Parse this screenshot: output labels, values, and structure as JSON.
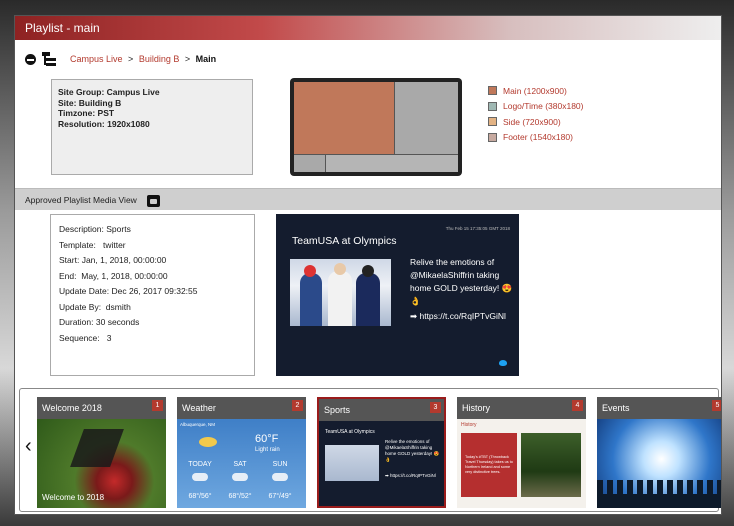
{
  "window": {
    "title": "Playlist - main"
  },
  "breadcrumb": {
    "items": [
      "Campus Live",
      "Building B"
    ],
    "current": "Main",
    "separator": ">"
  },
  "site_info": {
    "site_group_label": "Site Group:",
    "site_group": "Campus Live",
    "site_label": "Site:",
    "site": "Building B",
    "timezone_label": "Timzone:",
    "timezone": "PST",
    "resolution_label": "Resolution:",
    "resolution": "1920x1080"
  },
  "layout_legend": [
    {
      "label": "Main (1200x900)",
      "color": "#c0785a"
    },
    {
      "label": "Logo/Time (380x180)",
      "color": "#9fb8b3"
    },
    {
      "label": "Side (720x900)",
      "color": "#e3b384"
    },
    {
      "label": "Footer (1540x180)",
      "color": "#c7aaa0"
    }
  ],
  "colors": {
    "main_zone": "#c0785a",
    "side_zone": "#a9a9a9",
    "footer_zone": "#b5b5b5",
    "accent": "#b33a2e"
  },
  "section": {
    "title": "Approved Playlist Media View"
  },
  "media": {
    "description_label": "Description:",
    "description": "Sports",
    "template_label": "Template:",
    "template": "twitter",
    "start_label": "Start:",
    "start": "Jan, 1, 2018, 00:00:00",
    "end_label": "End:",
    "end": "May, 1, 2018, 00:00:00",
    "update_date_label": "Update Date:",
    "update_date": "Dec 26, 2017 09:32:55",
    "update_by_label": "Update By:",
    "update_by": "dsmith",
    "duration_label": "Duration:",
    "duration": "30 seconds",
    "sequence_label": "Sequence:",
    "sequence": "3"
  },
  "tweet": {
    "timestamp": "Thu Feb 15 17:35:05 GMT 2018",
    "title": "TeamUSA at Olympics",
    "text": "Relive the emotions of @MikaelaShiffrin taking home GOLD yesterday! 😍👌",
    "link": "➡ https://t.co/RqIPTvGiNl"
  },
  "carousel": {
    "prev": "‹",
    "next": "›",
    "items": [
      {
        "title": "Welcome 2018",
        "num": "1",
        "caption": "Welcome to 2018"
      },
      {
        "title": "Weather",
        "num": "2",
        "city": "Albuquerque, NM",
        "temp": "60°F",
        "cond": "Light rain",
        "days": [
          {
            "d": "TODAY",
            "t": "68°/56°"
          },
          {
            "d": "SAT",
            "t": "68°/52°"
          },
          {
            "d": "SUN",
            "t": "67°/49°"
          }
        ]
      },
      {
        "title": "Sports",
        "num": "3",
        "mini_title": "TeamUSA at Olympics",
        "mini_text": "Relive the emotions of @MikaelaShiffrin taking home GOLD yesterday! 😍👌",
        "mini_link": "➡ https://t.co/RqIPTvGiNl"
      },
      {
        "title": "History",
        "num": "4",
        "tag": "History",
        "text": "Today's #TBT (Throwback Travel Thursday) takes us to Northern Ireland and some very distinctive trees."
      },
      {
        "title": "Events",
        "num": "5"
      }
    ]
  }
}
